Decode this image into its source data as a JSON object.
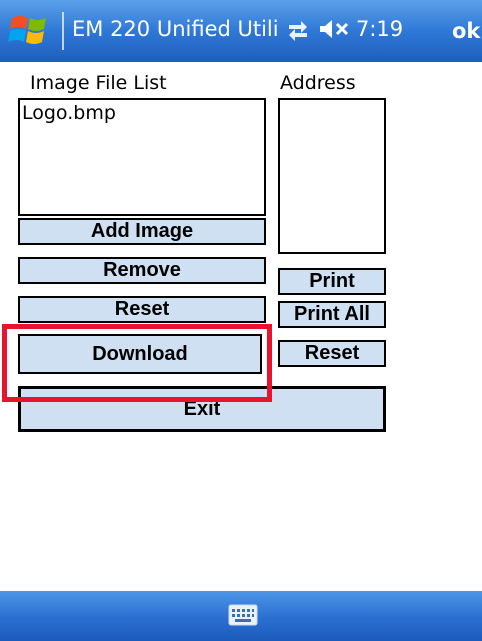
{
  "titlebar": {
    "title": "EM 220 Unified Utili",
    "time": "7:19",
    "ok_label": "ok",
    "icons": [
      "windows-start-icon",
      "connectivity-icon",
      "volume-muted-icon"
    ]
  },
  "left_panel": {
    "label": "Image File List",
    "items": [
      "Logo.bmp"
    ],
    "buttons": {
      "add_image": "Add Image",
      "remove": "Remove",
      "reset": "Reset",
      "download": "Download"
    }
  },
  "right_panel": {
    "label": "Address",
    "buttons": {
      "print": "Print",
      "print_all": "Print All",
      "reset": "Reset"
    }
  },
  "exit_label": "Exit",
  "bottombar": {
    "icon": "keyboard-icon"
  },
  "colors": {
    "button_bg": "#cfe0f3",
    "highlight": "#e8132c",
    "bar_blue": "#2f78d6"
  }
}
